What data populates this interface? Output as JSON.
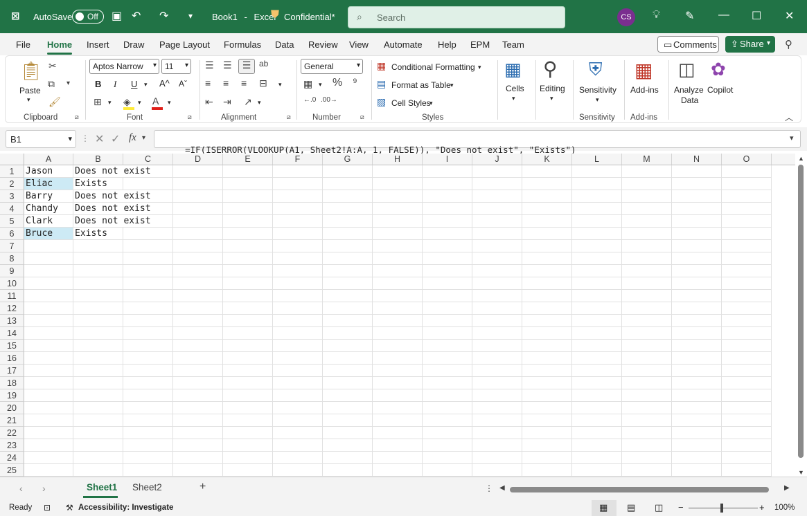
{
  "titlebar": {
    "autosave_label": "AutoSave",
    "autosave_state": "Off",
    "filename": "Book1",
    "separator": "-",
    "app": "Excel",
    "sensitivity_label": "Confidential*",
    "search_placeholder": "Search",
    "user_initials": "CS"
  },
  "tabs": [
    "File",
    "Home",
    "Insert",
    "Draw",
    "Page Layout",
    "Formulas",
    "Data",
    "Review",
    "View",
    "Automate",
    "Help",
    "EPM",
    "Team"
  ],
  "header_buttons": {
    "comments": "Comments",
    "share": "Share"
  },
  "ribbon": {
    "clipboard": {
      "paste": "Paste",
      "label": "Clipboard"
    },
    "font": {
      "name": "Aptos Narrow",
      "size": "11",
      "label": "Font",
      "bold": "B",
      "italic": "I",
      "underline": "U"
    },
    "alignment": {
      "label": "Alignment"
    },
    "number": {
      "format": "General",
      "label": "Number"
    },
    "styles": {
      "conditional": "Conditional Formatting",
      "format_table": "Format as Table",
      "cell_styles": "Cell Styles",
      "label": "Styles"
    },
    "cells": {
      "label": "Cells"
    },
    "editing": {
      "label": "Editing"
    },
    "sensitivity": {
      "button": "Sensitivity",
      "label": "Sensitivity"
    },
    "addins": {
      "button": "Add-ins",
      "label": "Add-ins"
    },
    "analyze": {
      "line1": "Analyze",
      "line2": "Data"
    },
    "copilot": {
      "button": "Copilot"
    }
  },
  "formula_bar": {
    "name_box": "B1",
    "fx": "fx",
    "formula": "=IF(ISERROR(VLOOKUP(A1, Sheet2!A:A, 1, FALSE)), \"Does not exist\", \"Exists\")"
  },
  "grid": {
    "columns": [
      "A",
      "B",
      "C",
      "D",
      "E",
      "F",
      "G",
      "H",
      "I",
      "J",
      "K",
      "L",
      "M",
      "N",
      "O"
    ],
    "rows": [
      "1",
      "2",
      "3",
      "4",
      "5",
      "6",
      "7",
      "8",
      "9",
      "10",
      "11",
      "12",
      "13",
      "14",
      "15",
      "16",
      "17",
      "18",
      "19",
      "20",
      "21",
      "22",
      "23",
      "24",
      "25"
    ],
    "data": [
      {
        "a": "Jason",
        "b": "Does not exist",
        "highlight": false
      },
      {
        "a": "Eliac",
        "b": "Exists",
        "highlight": true
      },
      {
        "a": "Barry",
        "b": "Does not exist",
        "highlight": false
      },
      {
        "a": "Chandy",
        "b": "Does not exist",
        "highlight": false
      },
      {
        "a": "Clark",
        "b": "Does not exist",
        "highlight": false
      },
      {
        "a": "Bruce",
        "b": "Exists",
        "highlight": true
      }
    ],
    "highlight_color": "#cdeaf5"
  },
  "sheets": {
    "tabs": [
      "Sheet1",
      "Sheet2"
    ],
    "active": "Sheet1",
    "add": "+"
  },
  "status": {
    "ready": "Ready",
    "accessibility": "Accessibility: Investigate",
    "zoom": "100%"
  },
  "colors": {
    "brand": "#217346"
  }
}
